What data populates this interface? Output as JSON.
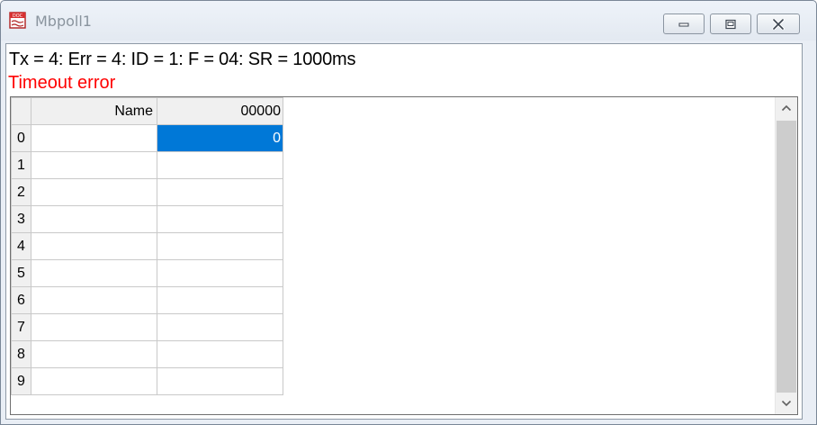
{
  "window": {
    "title": "Mbpoll1",
    "icon": "doc-icon",
    "icon_label": "DOC",
    "controls": [
      "minimize-icon",
      "maximize-icon",
      "close-icon"
    ]
  },
  "status": {
    "text": "Tx = 4: Err = 4: ID = 1: F = 04: SR = 1000ms",
    "error": "Timeout error",
    "error_color": "#ff0000"
  },
  "grid": {
    "headers": {
      "name": "Name",
      "col0": "00000"
    },
    "rows": [
      {
        "index": "0",
        "name": "",
        "value": "0",
        "selected": true
      },
      {
        "index": "1",
        "name": "",
        "value": ""
      },
      {
        "index": "2",
        "name": "",
        "value": ""
      },
      {
        "index": "3",
        "name": "",
        "value": ""
      },
      {
        "index": "4",
        "name": "",
        "value": ""
      },
      {
        "index": "5",
        "name": "",
        "value": ""
      },
      {
        "index": "6",
        "name": "",
        "value": ""
      },
      {
        "index": "7",
        "name": "",
        "value": ""
      },
      {
        "index": "8",
        "name": "",
        "value": ""
      },
      {
        "index": "9",
        "name": "",
        "value": ""
      }
    ],
    "selection_color": "#0078d7"
  }
}
